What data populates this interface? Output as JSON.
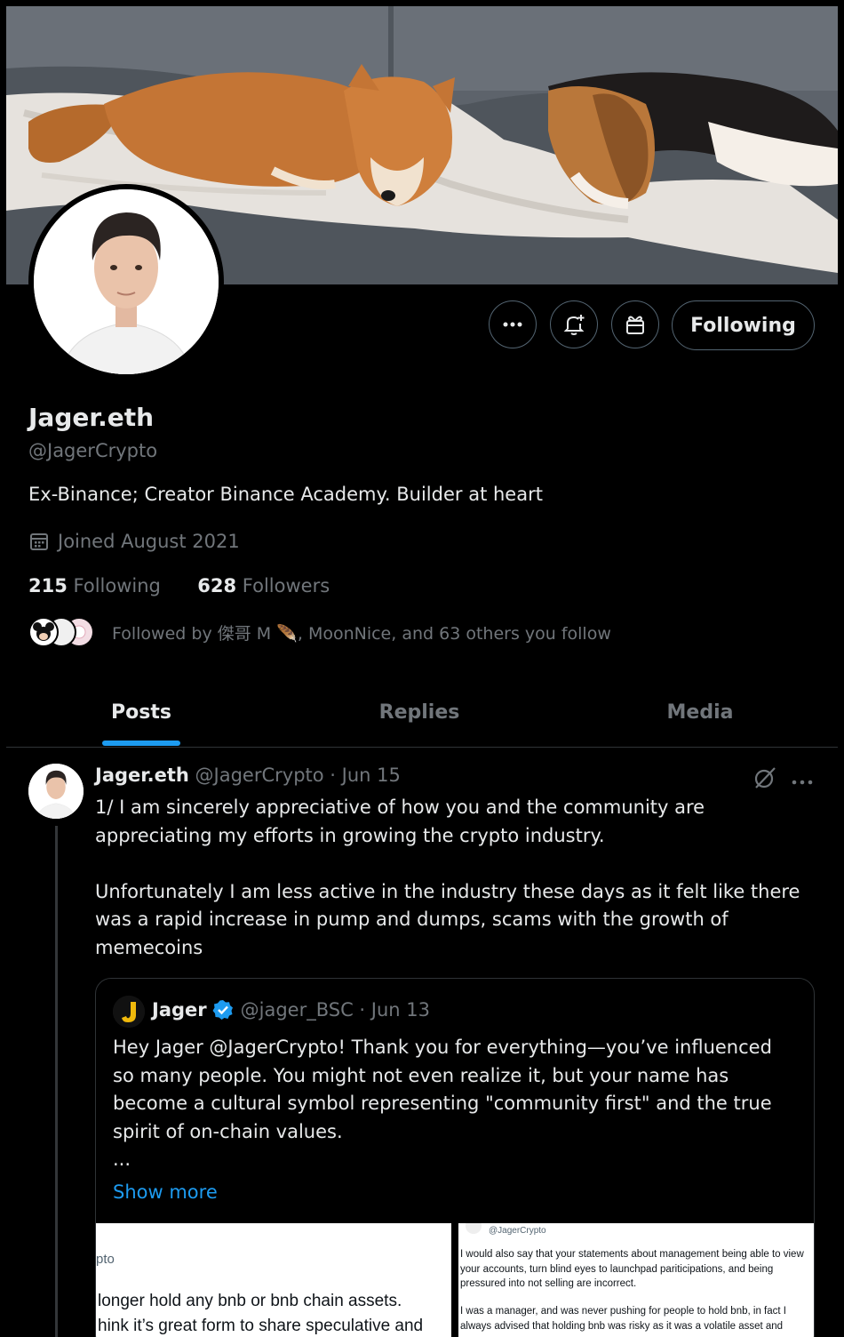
{
  "profile": {
    "name": "Jager.eth",
    "handle": "@JagerCrypto",
    "bio": "Ex-Binance; Creator Binance Academy. Builder at heart",
    "joined": "Joined August 2021",
    "following_count": "215",
    "following_label": "Following",
    "followers_count": "628",
    "followers_label": "Followers",
    "followed_by": "Followed by 傑哥 M 🪶, MoonNice, and 63 others you follow"
  },
  "actions": {
    "follow_button": "Following"
  },
  "tabs": [
    {
      "label": "Posts",
      "active": true
    },
    {
      "label": "Replies",
      "active": false
    },
    {
      "label": "Media",
      "active": false
    }
  ],
  "post": {
    "author": "Jager.eth",
    "meta": "@JagerCrypto · Jun 15",
    "text": "1/ I am sincerely appreciative of how you and the community are appreciating my efforts in growing the crypto industry.\n\nUnfortunately I am less active in the industry these days as it felt like there was a rapid increase in pump and dumps, scams with the growth of memecoins"
  },
  "quote": {
    "author": "Jager",
    "meta": "@jager_BSC · Jun 13",
    "text": "Hey Jager @JagerCrypto! Thank you for everything—you’ve influenced so many people. You might not even realize it, but your name has become a cultural symbol representing \"community first\" and the true spirit of on-chain values.\n...",
    "show_more": "Show more",
    "image_left_handle": "pto",
    "image_left_text": "longer hold any bnb or bnb chain assets.\nhink it’s great form to share speculative and",
    "image_right_handle": "@JagerCrypto",
    "image_right_text1": "I would also say that your statements about management being able to view your accounts, turn blind eyes to launchpad pariticipations, and being pressured into not selling are incorrect.",
    "image_right_text2": "I was a manager, and was never pushing for people to hold bnb, in fact I always advised that holding bnb was risky as it was a volatile asset and"
  },
  "colors": {
    "accent": "#1d9bf0",
    "background": "#000000",
    "border": "#2f3336",
    "muted": "#71767b"
  }
}
